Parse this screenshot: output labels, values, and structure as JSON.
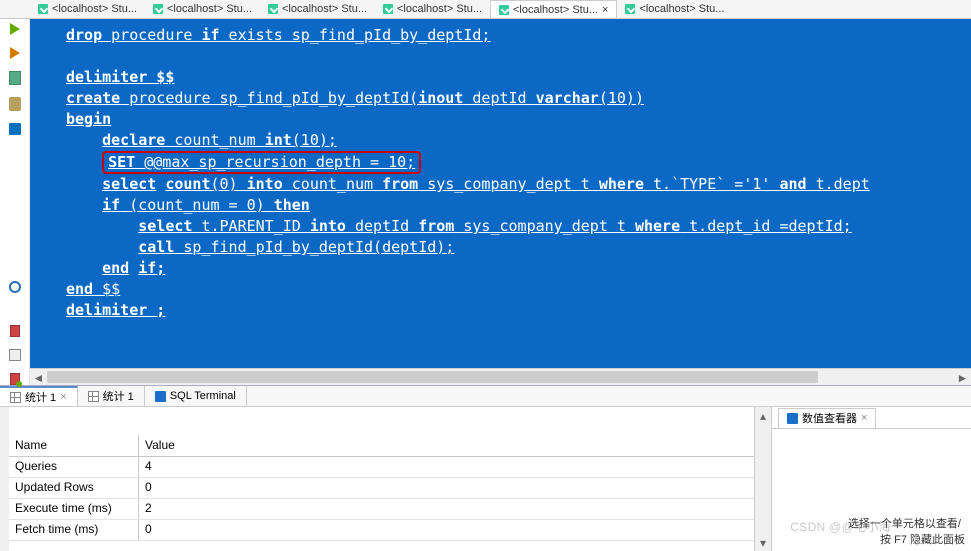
{
  "top_tabs": {
    "items": [
      {
        "label": "<localhost>  Stu..."
      },
      {
        "label": "<localhost>  Stu..."
      },
      {
        "label": "<localhost>  Stu..."
      },
      {
        "label": "<localhost>  Stu..."
      },
      {
        "label": "<localhost>  Stu..."
      },
      {
        "label": "<localhost>  Stu..."
      }
    ],
    "active_index": 4,
    "close_glyph": "×"
  },
  "code": {
    "l1a": "drop",
    "l1b": " procedure ",
    "l1c": "if",
    "l1d": " exists sp_find_pId_by_deptId;",
    "l3": "delimiter $$",
    "l4a": "create",
    "l4b": " procedure sp_find_pId_by_deptId(",
    "l4c": "inout",
    "l4d": " deptId ",
    "l4e": "varchar",
    "l4f": "(10))",
    "l5": "begin",
    "l6a": "    ",
    "l6b": "declare",
    "l6c": " count_num ",
    "l6d": "int",
    "l6e": "(10);",
    "l7a": "    ",
    "l7b": "SET",
    "l7c": " @@max_sp_recursion_depth = 10;",
    "l8a": "    ",
    "l8b": "select",
    "l8c": " ",
    "l8d": "count",
    "l8e": "(0) ",
    "l8f": "into",
    "l8g": " count_num ",
    "l8h": "from",
    "l8i": " sys_company_dept t ",
    "l8j": "where",
    "l8k": " t.`TYPE` ='1' ",
    "l8l": "and",
    "l8m": " t.dept",
    "l9a": "    ",
    "l9b": "if",
    "l9c": " (count_num = 0) ",
    "l9d": "then",
    "l10a": "        ",
    "l10b": "select",
    "l10c": " t.PARENT_ID ",
    "l10d": "into",
    "l10e": " deptId ",
    "l10f": "from",
    "l10g": " sys_company_dept t ",
    "l10h": "where",
    "l10i": " t.dept_id =deptId;",
    "l11a": "        ",
    "l11b": "call",
    "l11c": " sp_find_pId_by_deptId(deptId);",
    "l12a": "    ",
    "l12b": "end",
    "l12c": " ",
    "l12d": "if;",
    "l13a": "end",
    "l13b": " $$",
    "l14": "delimiter ;"
  },
  "bottom_tabs": {
    "t1": "统计 1",
    "t2": "统计 1",
    "t3": "SQL Terminal"
  },
  "stats": {
    "hdr_name": "Name",
    "hdr_value": "Value",
    "rows": [
      {
        "name": "Queries",
        "value": "4"
      },
      {
        "name": "Updated Rows",
        "value": "0"
      },
      {
        "name": "Execute time (ms)",
        "value": "2"
      },
      {
        "name": "Fetch time (ms)",
        "value": "0"
      }
    ]
  },
  "viewer": {
    "tab_label": "数值查看器",
    "hint": "选择一个单元格以查看/",
    "footer": "按 F7 隐藏此面板"
  },
  "watermark": "CSDN @@宅小海",
  "glyphs": {
    "left": "◄",
    "right": "►",
    "up": "▴",
    "down": "▾",
    "x": "×"
  }
}
